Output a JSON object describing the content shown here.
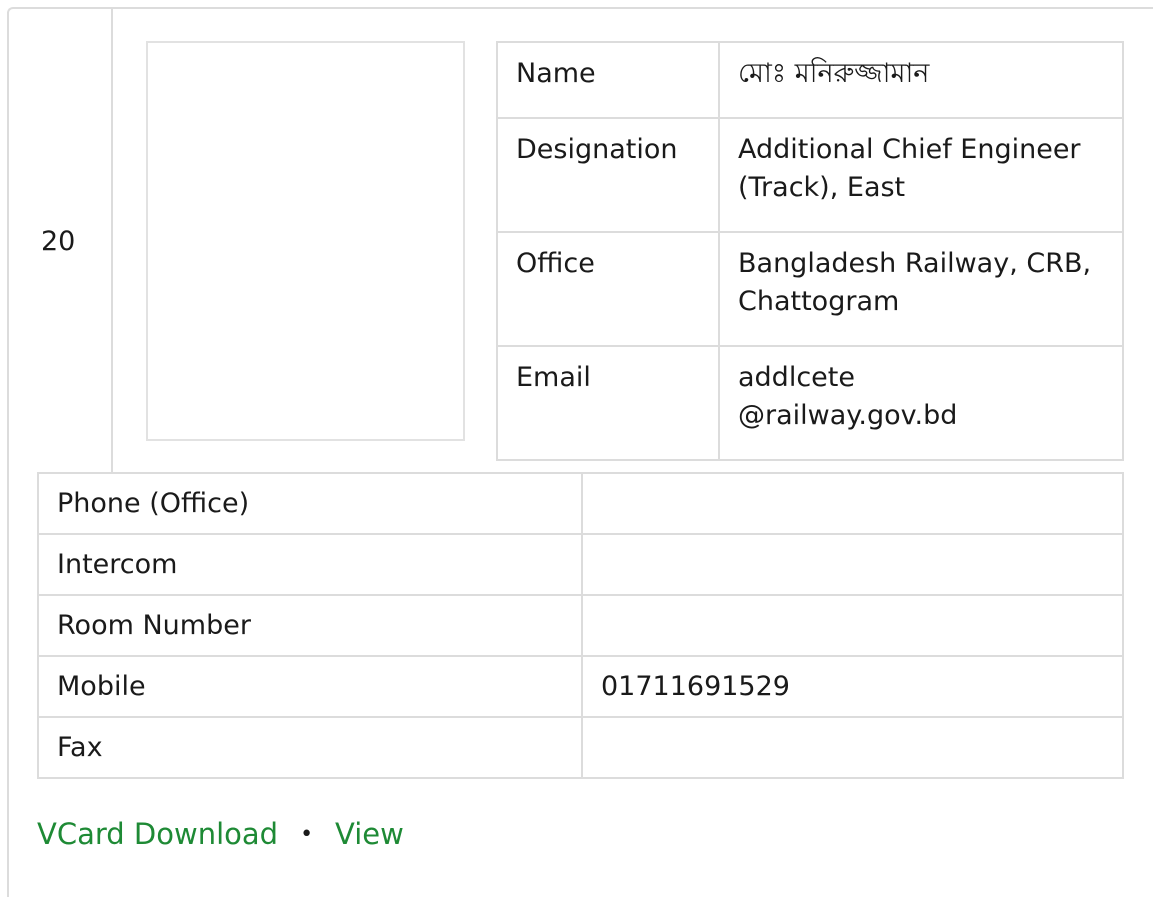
{
  "entry": {
    "index": "20",
    "info": {
      "name_label": "Name",
      "name_value": "মোঃ মনিরুজ্জামান",
      "designation_label": "Designation",
      "designation_value": "Additional Chief Engineer (Track), East",
      "office_label": "Office",
      "office_value": "Bangladesh Railway, CRB, Chattogram",
      "email_label": "Email",
      "email_value_user": "addlcete",
      "email_value_domain": "@railway.gov.bd"
    },
    "contacts": {
      "phone_office_label": "Phone (Office)",
      "phone_office_value": "",
      "intercom_label": "Intercom",
      "intercom_value": "",
      "room_number_label": "Room Number",
      "room_number_value": "",
      "mobile_label": "Mobile",
      "mobile_value": "01711691529",
      "fax_label": "Fax",
      "fax_value": ""
    },
    "links": {
      "vcard_label": "VCard Download",
      "separator": "•",
      "view_label": "View"
    }
  },
  "colors": {
    "link": "#1e8a35",
    "border": "#dcdcdc"
  }
}
